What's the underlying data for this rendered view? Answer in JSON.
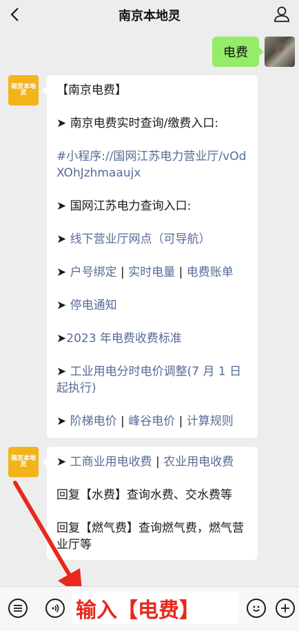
{
  "header": {
    "title": "南京本地灵",
    "back_icon": "chevron-left-icon",
    "profile_icon": "person-icon"
  },
  "chat": {
    "my_message": "电费",
    "bot_avatar_text": "南京本地灵",
    "message1": {
      "heading": "【南京电费】",
      "line1": "➤ 南京电费实时查询/缴费入口:",
      "miniprogram_link": "#小程序://国网江苏电力营业厅/vOdXOhJzhmaaujx",
      "line2": "➤ 国网江苏电力查询入口:",
      "arrow": "➤ ",
      "item_offline": "线下营业厅网点（可导航）",
      "item_bind": "户号绑定",
      "item_realtime": "实时电量",
      "item_bill": "电费账单",
      "item_outage": "停电通知",
      "arrow_tight": "➤",
      "item_standard": "2023 年电费收费标准",
      "item_industrial": "工业用电分时电价调整(7 月 1 日起执行)",
      "item_tier": "阶梯电价",
      "item_peak": "峰谷电价",
      "item_rule": "计算规则",
      "separator": " | "
    },
    "message2": {
      "arrow": "➤ ",
      "item_commercial": "工商业用电收费",
      "item_agri": "农业用电收费",
      "separator": " | ",
      "reply_water": "回复【水费】查询水费、交水费等",
      "reply_gas": "回复【燃气费】查询燃气费，燃气营业厅等"
    }
  },
  "bottom": {
    "menu_icon": "list-icon",
    "voice_icon": "voice-icon",
    "input_value": "输入【电费】",
    "emoji_icon": "emoji-icon",
    "plus_icon": "plus-icon"
  },
  "colors": {
    "link": "#576b95",
    "my_bubble": "#95ec69",
    "annotation": "#e8281c",
    "avatar": "#f3b31a"
  }
}
